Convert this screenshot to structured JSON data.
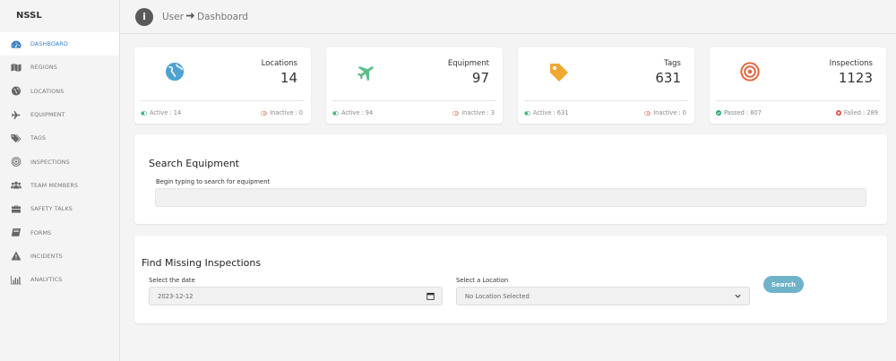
{
  "brand": "NSSL",
  "breadcrumb": {
    "info": "i",
    "first": "User",
    "second": "Dashboard"
  },
  "colors": {
    "accent": "#3b7fc4",
    "active_green": "#2ca86a",
    "inactive_red": "#e26b4f",
    "search_btn": "#6fb3c9"
  },
  "sidebar": {
    "items": [
      {
        "label": "DASHBOARD",
        "icon": "speedometer-icon",
        "active": true
      },
      {
        "label": "REGIONS",
        "icon": "map-icon"
      },
      {
        "label": "LOCATIONS",
        "icon": "globe-icon"
      },
      {
        "label": "EQUIPMENT",
        "icon": "plane-icon"
      },
      {
        "label": "TAGS",
        "icon": "tags-icon"
      },
      {
        "label": "INSPECTIONS",
        "icon": "target-icon"
      },
      {
        "label": "TEAM MEMBERS",
        "icon": "users-icon"
      },
      {
        "label": "SAFETY TALKS",
        "icon": "briefcase-icon"
      },
      {
        "label": "FORMS",
        "icon": "book-icon"
      },
      {
        "label": "INCIDENTS",
        "icon": "warning-icon"
      },
      {
        "label": "ANALYTICS",
        "icon": "bar-chart-icon"
      }
    ]
  },
  "stats": [
    {
      "label": "Locations",
      "value": "14",
      "left": "Active : 14",
      "right": "Inactive : 0",
      "icon": "globe-icon"
    },
    {
      "label": "Equipment",
      "value": "97",
      "left": "Active : 94",
      "right": "Inactive : 3",
      "icon": "plane-icon"
    },
    {
      "label": "Tags",
      "value": "631",
      "left": "Active : 631",
      "right": "Inactive : 0",
      "icon": "tag-icon"
    },
    {
      "label": "Inspections",
      "value": "1123",
      "left": "Passed : 807",
      "right": "Failed : 289",
      "icon": "target-icon"
    }
  ],
  "search_equipment": {
    "title": "Search Equipment",
    "hint": "Begin typing to search for equipment",
    "value": ""
  },
  "missing_inspections": {
    "title": "Find Missing Inspections",
    "date_label": "Select the date",
    "date_value": "2023-12-12",
    "location_label": "Select a Location",
    "location_value": "No Location Selected",
    "search_label": "Search"
  }
}
